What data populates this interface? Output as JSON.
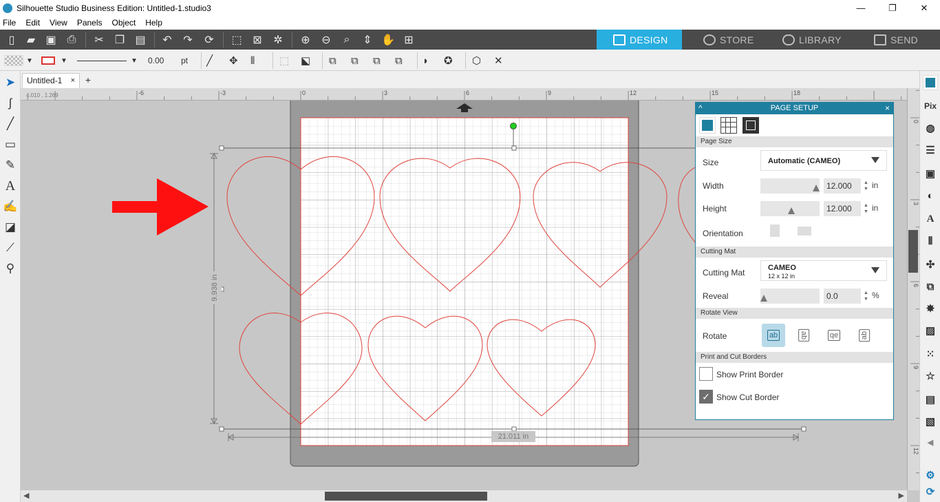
{
  "window": {
    "title": "Silhouette Studio Business Edition: Untitled-1.studio3",
    "min": "—",
    "restore": "❐",
    "close": "✕"
  },
  "menu": [
    "File",
    "Edit",
    "View",
    "Panels",
    "Object",
    "Help"
  ],
  "nav_tabs": {
    "design": "DESIGN",
    "store": "STORE",
    "library": "LIBRARY",
    "send": "SEND"
  },
  "toolbar2": {
    "line_width": "0.00",
    "line_unit": "pt"
  },
  "doc_tab": {
    "label": "Untitled-1",
    "close": "×",
    "add": "+"
  },
  "ruler": {
    "coords": "4.010 , 1.269",
    "h_ticks": [
      "-6",
      "-3",
      "0",
      "3",
      "6",
      "9",
      "12",
      "15",
      "18"
    ],
    "v_ticks": [
      "0",
      "3",
      "6",
      "9",
      "12"
    ]
  },
  "selection": {
    "height_label": "9.938 in",
    "width_label": "21.011 in"
  },
  "page_setup": {
    "title": "PAGE SETUP",
    "collapse": "^",
    "close": "×",
    "sections": {
      "page_size": "Page Size",
      "cutting_mat": "Cutting Mat",
      "rotate_view": "Rotate View",
      "borders": "Print and Cut Borders"
    },
    "size_label": "Size",
    "size_value": "Automatic (CAMEO)",
    "width_label": "Width",
    "width_value": "12.000",
    "height_label": "Height",
    "height_value": "12.000",
    "unit_in": "in",
    "orientation_label": "Orientation",
    "mat_label": "Cutting Mat",
    "mat_name": "CAMEO",
    "mat_size": "12 x 12 in",
    "reveal_label": "Reveal",
    "reveal_value": "0.0",
    "unit_pct": "%",
    "rotate_label": "Rotate",
    "rotate_options": [
      "ab",
      "ab",
      "qe",
      "ab"
    ],
    "show_print_border": "Show Print Border",
    "show_cut_border": "Show Cut Border",
    "print_border_checked": false,
    "cut_border_checked": true
  },
  "colors": {
    "accent": "#29aee0",
    "panel_header": "#1f7f9f",
    "cut_line": "#e0443c",
    "arrow": "#ff1010"
  }
}
